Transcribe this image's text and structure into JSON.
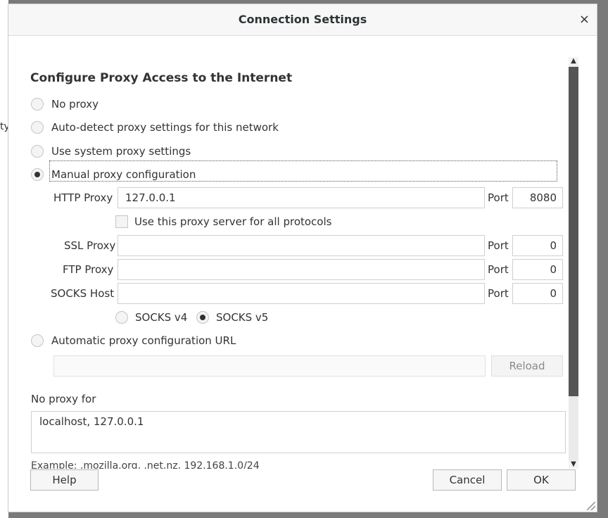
{
  "background": {
    "text": "ty"
  },
  "dialog": {
    "title": "Connection Settings",
    "close_icon": "×"
  },
  "proxy": {
    "heading": "Configure Proxy Access to the Internet",
    "options": {
      "no_proxy": "No proxy",
      "auto_detect": "Auto-detect proxy settings for this network",
      "system": "Use system proxy settings",
      "manual": "Manual proxy configuration",
      "auto_url": "Automatic proxy configuration URL"
    },
    "selected": "manual",
    "http": {
      "label": "HTTP Proxy",
      "value": "127.0.0.1",
      "port_label": "Port",
      "port": "8080"
    },
    "use_all_label": "Use this proxy server for all protocols",
    "use_all_checked": false,
    "ssl": {
      "label": "SSL Proxy",
      "value": "",
      "port_label": "Port",
      "port": "0"
    },
    "ftp": {
      "label": "FTP Proxy",
      "value": "",
      "port_label": "Port",
      "port": "0"
    },
    "socks": {
      "label": "SOCKS Host",
      "value": "",
      "port_label": "Port",
      "port": "0"
    },
    "socks_v4": "SOCKS v4",
    "socks_v5": "SOCKS v5",
    "socks_selected": "v5",
    "auto_url_value": "",
    "reload_label": "Reload",
    "no_proxy_label": "No proxy for",
    "no_proxy_value": "localhost, 127.0.0.1",
    "example": "Example: .mozilla.org, .net.nz, 192.168.1.0/24"
  },
  "buttons": {
    "help": "Help",
    "cancel": "Cancel",
    "ok": "OK"
  },
  "scrollbar": {
    "up_icon": "▲",
    "down_icon": "▼"
  }
}
